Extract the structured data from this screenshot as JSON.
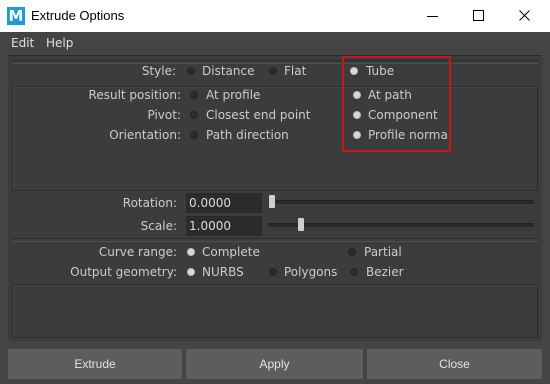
{
  "window": {
    "app_icon_letter": "M",
    "title": "Extrude Options",
    "minimize_glyph": "minimize-icon",
    "maximize_glyph": "maximize-icon",
    "close_glyph": "close-icon"
  },
  "menu": [
    "Edit",
    "Help"
  ],
  "options": {
    "style": {
      "label": "Style:",
      "choices": [
        "Distance",
        "Flat",
        "Tube"
      ],
      "selected": "Tube"
    },
    "result_position": {
      "label": "Result position:",
      "choices": [
        "At profile",
        "At path"
      ],
      "selected": "At path"
    },
    "pivot": {
      "label": "Pivot:",
      "choices": [
        "Closest end point",
        "Component"
      ],
      "selected": "Component"
    },
    "orientation": {
      "label": "Orientation:",
      "choices": [
        "Path direction",
        "Profile normal"
      ],
      "selected": "Profile normal"
    }
  },
  "sliders": {
    "rotation": {
      "label": "Rotation:",
      "value": "0.0000",
      "slider_fraction": 0.0
    },
    "scale": {
      "label": "Scale:",
      "value": "1.0000",
      "slider_fraction": 0.11
    }
  },
  "curve_range": {
    "label": "Curve range:",
    "choices": [
      "Complete",
      "Partial"
    ],
    "selected": "Complete"
  },
  "output_geometry": {
    "label": "Output geometry:",
    "choices": [
      "NURBS",
      "Polygons",
      "Bezier"
    ],
    "selected": "NURBS"
  },
  "buttons": {
    "extrude": "Extrude",
    "apply": "Apply",
    "close": "Close"
  },
  "colors": {
    "highlight_box": "#c8161d",
    "app_icon": "#1a9bd7"
  }
}
